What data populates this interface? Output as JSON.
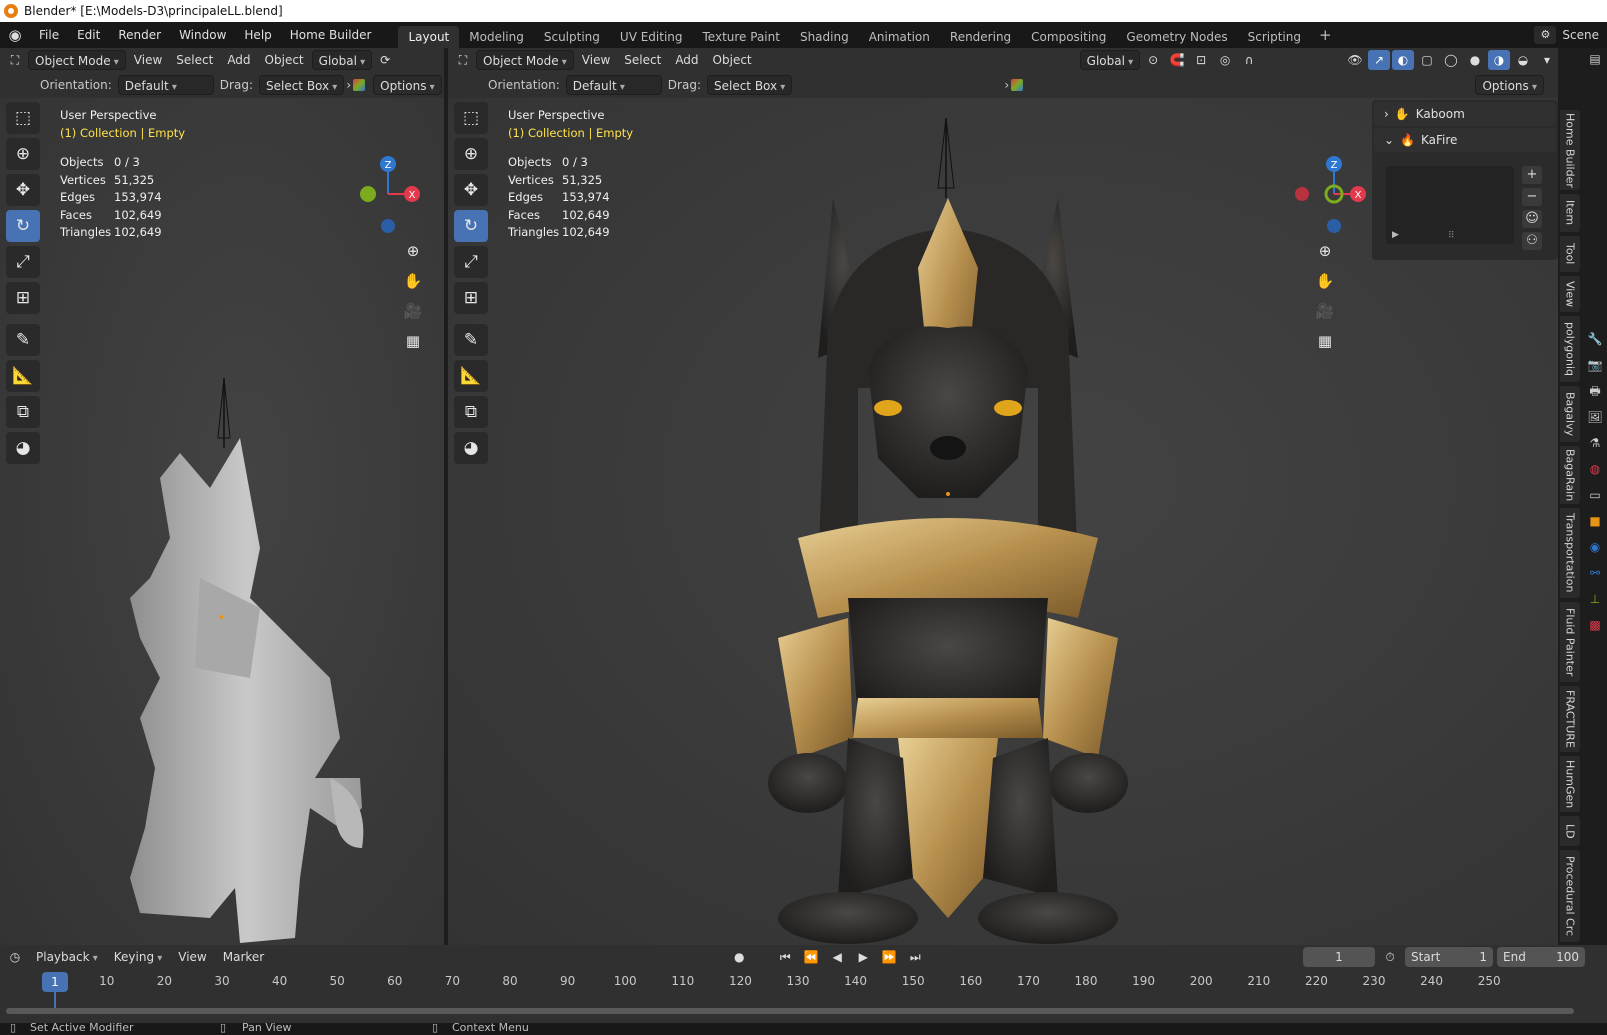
{
  "window": {
    "title": "Blender* [E:\\Models-D3\\principaleLL.blend]"
  },
  "menu": [
    "File",
    "Edit",
    "Render",
    "Window",
    "Help",
    "Home Builder"
  ],
  "workspaces": [
    "Layout",
    "Modeling",
    "Sculpting",
    "UV Editing",
    "Texture Paint",
    "Shading",
    "Animation",
    "Rendering",
    "Compositing",
    "Geometry Nodes",
    "Scripting"
  ],
  "active_workspace": "Layout",
  "scene_name": "Scene",
  "viewport_header": {
    "mode": "Object Mode",
    "view": "View",
    "select": "Select",
    "add": "Add",
    "object": "Object",
    "transform_orientation": "Global"
  },
  "tool_settings": {
    "orientation_label": "Orientation:",
    "orientation_value": "Default",
    "drag_label": "Drag:",
    "drag_value": "Select Box",
    "options": "Options"
  },
  "viewport_overlay": {
    "perspective": "User Perspective",
    "collection": "(1) Collection | Empty",
    "stats": [
      {
        "label": "Objects",
        "value": "0 / 3"
      },
      {
        "label": "Vertices",
        "value": "51,325"
      },
      {
        "label": "Edges",
        "value": "153,974"
      },
      {
        "label": "Faces",
        "value": "102,649"
      },
      {
        "label": "Triangles",
        "value": "102,649"
      }
    ]
  },
  "gizmo_axes": {
    "z": "Z",
    "x": "X"
  },
  "n_panel": {
    "items": [
      {
        "label": "Kaboom",
        "expanded": false
      },
      {
        "label": "KaFire",
        "expanded": true
      }
    ]
  },
  "sidebar_tabs": [
    "Home Builder",
    "Item",
    "Tool",
    "View",
    "polygoniq",
    "Bagalvy",
    "BagaRain",
    "Transportation",
    "Fluid Painter",
    "FRACTURE",
    "HumGen",
    "LD",
    "Procedural Crc"
  ],
  "timeline": {
    "playback": "Playback",
    "keying": "Keying",
    "view": "View",
    "marker": "Marker",
    "current_frame": "1",
    "start_label": "Start",
    "start_value": "1",
    "end_label": "End",
    "end_value": "100",
    "ticks": [
      "10",
      "20",
      "30",
      "40",
      "50",
      "60",
      "70",
      "80",
      "90",
      "100",
      "110",
      "120",
      "130",
      "140",
      "150",
      "160",
      "170",
      "180",
      "190",
      "200",
      "210",
      "220",
      "230",
      "240",
      "250"
    ],
    "marker_frame": "1"
  },
  "statusbar": [
    "Set Active Modifier",
    "Pan View",
    "Context Menu"
  ],
  "colors": {
    "accent": "#4772b3",
    "axis_x": "#e2394c",
    "axis_y": "#7cab1e",
    "axis_z": "#2f78d2",
    "overlay_yellow": "#ffe24a",
    "gold": "#c9a35b"
  }
}
